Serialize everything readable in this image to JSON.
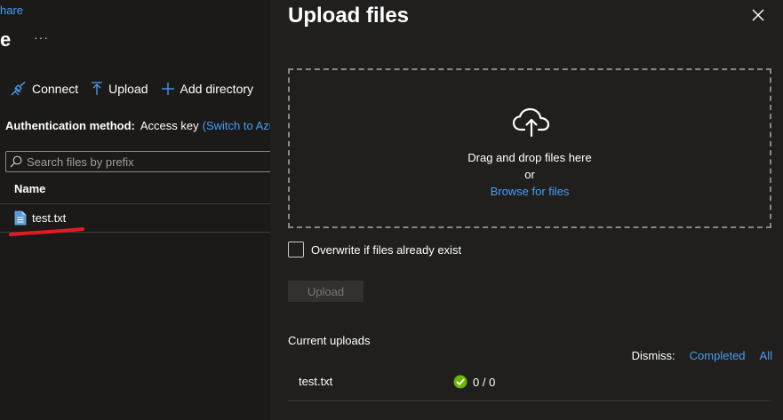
{
  "left": {
    "breadcrumb_fragment": "hare",
    "title_fragment": "e",
    "more_label": "···",
    "toolbar": {
      "connect_label": "Connect",
      "upload_label": "Upload",
      "add_directory_label": "Add directory"
    },
    "auth": {
      "label": "Authentication method:",
      "value": "Access key",
      "switch_link": "(Switch to Azu"
    },
    "search": {
      "placeholder": "Search files by prefix"
    },
    "table": {
      "column_name": "Name",
      "rows": [
        {
          "name": "test.txt"
        }
      ]
    },
    "annotation_color": "#e01b24"
  },
  "panel": {
    "title": "Upload files",
    "dropzone": {
      "text": "Drag and drop files here",
      "or": "or",
      "browse": "Browse for files"
    },
    "overwrite_label": "Overwrite if files already exist",
    "upload_button": "Upload",
    "current_uploads_label": "Current uploads",
    "dismiss": {
      "label": "Dismiss:",
      "completed": "Completed",
      "all": "All"
    },
    "uploads": [
      {
        "name": "test.txt",
        "progress": "0 / 0",
        "status": "success"
      }
    ]
  },
  "colors": {
    "link": "#479ef5",
    "success": "#6bb700",
    "background": "#1b1a19",
    "panel": "#201f1e"
  }
}
